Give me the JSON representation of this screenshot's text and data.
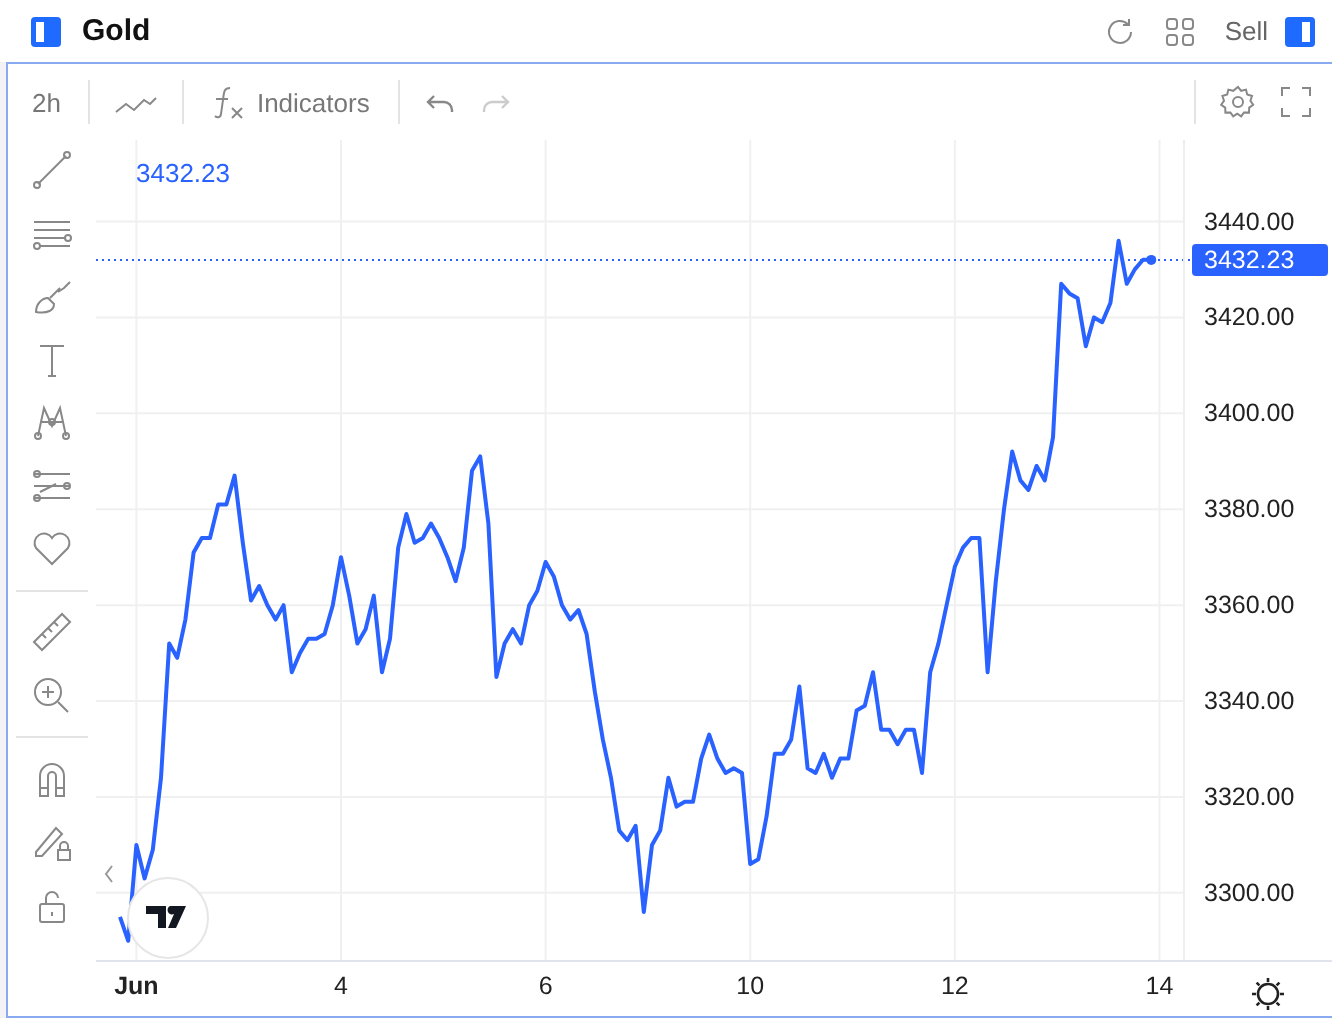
{
  "header": {
    "title": "Gold",
    "trade_label": "Sell"
  },
  "toolbar": {
    "interval": "2h",
    "indicators": "Indicators",
    "history": [
      {
        "kind": "undo",
        "disabled": false
      },
      {
        "kind": "redo",
        "disabled": true
      }
    ]
  },
  "legend": {
    "price": "3432.23"
  },
  "last_price_label": "3432.23",
  "chart_data": {
    "type": "line",
    "grid": true,
    "ylim": [
      3286,
      3457
    ],
    "ref_lines": [
      {
        "axis": "y",
        "value": 3432
      }
    ],
    "categories": [
      null,
      null,
      "Jun",
      null,
      null,
      null,
      null,
      null,
      null,
      null,
      null,
      null,
      null,
      null,
      null,
      null,
      null,
      null,
      null,
      null,
      null,
      null,
      null,
      null,
      null,
      null,
      null,
      "4",
      null,
      null,
      null,
      null,
      null,
      null,
      null,
      null,
      null,
      null,
      null,
      null,
      null,
      null,
      null,
      null,
      null,
      null,
      null,
      null,
      null,
      null,
      null,
      null,
      "6",
      null,
      null,
      null,
      null,
      null,
      null,
      null,
      null,
      null,
      null,
      null,
      null,
      null,
      null,
      null,
      null,
      null,
      null,
      null,
      null,
      null,
      null,
      null,
      null,
      "10",
      null,
      null,
      null,
      null,
      null,
      null,
      null,
      null,
      null,
      null,
      null,
      null,
      null,
      null,
      null,
      null,
      null,
      null,
      null,
      null,
      null,
      null,
      null,
      null,
      "12",
      null,
      null,
      null,
      null,
      null,
      null,
      null,
      null,
      null,
      null,
      null,
      null,
      null,
      null,
      null,
      null,
      null,
      null,
      null,
      null,
      null,
      null,
      null,
      null,
      "14"
    ],
    "yticks": [
      {
        "value": 3300,
        "label": "3300.00"
      },
      {
        "value": 3320,
        "label": "3320.00"
      },
      {
        "value": 3340,
        "label": "3340.00"
      },
      {
        "value": 3360,
        "label": "3360.00"
      },
      {
        "value": 3380,
        "label": "3380.00"
      },
      {
        "value": 3400,
        "label": "3400.00"
      },
      {
        "value": 3420,
        "label": "3420.00"
      },
      {
        "value": 3440,
        "label": "3440.00"
      }
    ],
    "series": [
      {
        "color": "#2962ff",
        "values": [
          3295,
          3290,
          3310,
          3303,
          3309,
          3324,
          3352,
          3349,
          3357,
          3371,
          3374,
          3374,
          3381,
          3381,
          3387,
          3373,
          3361,
          3364,
          3360,
          3357,
          3360,
          3346,
          3350,
          3353,
          3353,
          3354,
          3360,
          3370,
          3362,
          3352,
          3355,
          3362,
          3346,
          3353,
          3372,
          3379,
          3373,
          3374,
          3377,
          3374,
          3370,
          3365,
          3372,
          3388,
          3391,
          3377,
          3345,
          3352,
          3355,
          3352,
          3360,
          3363,
          3369,
          3366,
          3360,
          3357,
          3359,
          3354,
          3342,
          3332,
          3324,
          3313,
          3311,
          3314,
          3296,
          3310,
          3313,
          3324,
          3318,
          3319,
          3319,
          3328,
          3333,
          3328,
          3325,
          3326,
          3325,
          3306,
          3307,
          3316,
          3329,
          3329,
          3332,
          3343,
          3326,
          3325,
          3329,
          3324,
          3328,
          3328,
          3338,
          3339,
          3346,
          3334,
          3334,
          3331,
          3334,
          3334,
          3325,
          3346,
          3352,
          3360,
          3368,
          3372,
          3374,
          3374,
          3346,
          3365,
          3380,
          3392,
          3386,
          3384,
          3389,
          3386,
          3395,
          3427,
          3425,
          3424,
          3414,
          3420,
          3419,
          3423,
          3436,
          3427,
          3430,
          3432,
          3432,
          null
        ]
      }
    ]
  }
}
